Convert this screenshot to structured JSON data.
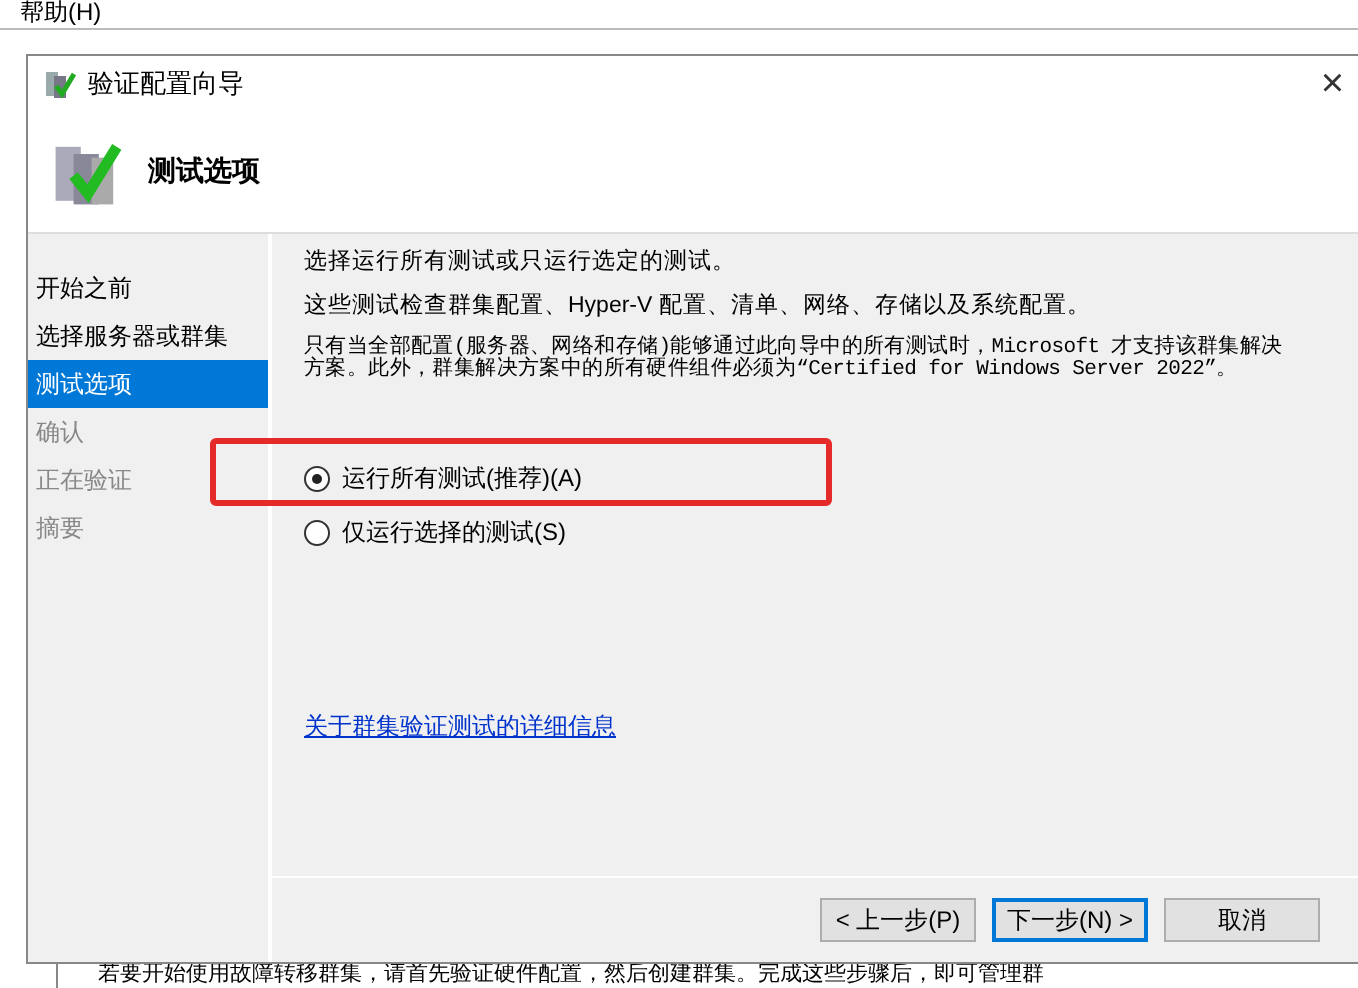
{
  "app_menu": {
    "label": "帮助(H)"
  },
  "dialog": {
    "title": "验证配置向导",
    "close": "×",
    "page_title": "测试选项",
    "steps": [
      {
        "label": "开始之前",
        "selected": false,
        "disabled": false
      },
      {
        "label": "选择服务器或群集",
        "selected": false,
        "disabled": false
      },
      {
        "label": "测试选项",
        "selected": true,
        "disabled": false
      },
      {
        "label": "确认",
        "selected": false,
        "disabled": true
      },
      {
        "label": "正在验证",
        "selected": false,
        "disabled": true
      },
      {
        "label": "摘要",
        "selected": false,
        "disabled": true
      }
    ],
    "paragraphs": [
      "选择运行所有测试或只运行选定的测试。",
      "这些测试检查群集配置、Hyper-V 配置、清单、网络、存储以及系统配置。",
      "只有当全部配置(服务器、网络和存储)能够通过此向导中的所有测试时，Microsoft 才支持该群集解决方案。此外，群集解决方案中的所有硬件组件必须为“Certified for Windows Server 2022”。"
    ],
    "options": [
      {
        "label": "运行所有测试(推荐)(A)",
        "selected": true
      },
      {
        "label": "仅运行选择的测试(S)",
        "selected": false
      }
    ],
    "link": "关于群集验证测试的详细信息",
    "buttons": [
      {
        "label": "< 上一步(P)",
        "focused": false
      },
      {
        "label": "下一步(N) >",
        "focused": true
      },
      {
        "label": "取消",
        "focused": false
      }
    ]
  },
  "background_text": "若要开始使用故障转移群集，请首先验证硬件配置，然后创建群集。完成这些步骤后，即可管理群"
}
